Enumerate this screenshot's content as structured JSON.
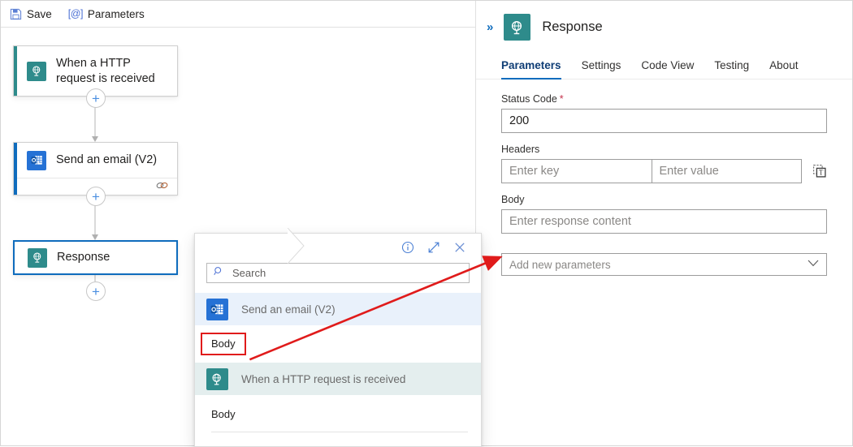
{
  "toolbar": {
    "save_label": "Save",
    "save_icon": "save-floppy-icon",
    "parameters_label": "Parameters",
    "parameters_icon": "at-parameters-icon"
  },
  "canvas": {
    "nodes": [
      {
        "id": "http-trigger",
        "label": "When a HTTP request is received",
        "icon": "http-request-globe-icon",
        "accent_color": "#2e8b8b",
        "selected": false
      },
      {
        "id": "send-email",
        "label": "Send an email (V2)",
        "icon": "outlook-email-icon",
        "accent_color": "#0f6cbd",
        "selected": false,
        "connection_icon": "chain-link-icon"
      },
      {
        "id": "response",
        "label": "Response",
        "icon": "response-globe-icon",
        "accent_color": "#0f6cbd",
        "selected": true
      }
    ],
    "add_button_label": "+"
  },
  "panel": {
    "collapse_icon": "double-chevron-right-icon",
    "header_icon": "response-globe-icon",
    "title": "Response",
    "tabs": [
      {
        "label": "Parameters",
        "active": true
      },
      {
        "label": "Settings",
        "active": false
      },
      {
        "label": "Code View",
        "active": false
      },
      {
        "label": "Testing",
        "active": false
      },
      {
        "label": "About",
        "active": false
      }
    ],
    "fields": {
      "status_code": {
        "label": "Status Code",
        "required_marker": "*",
        "value": "200"
      },
      "headers": {
        "label": "Headers",
        "key_placeholder": "Enter key",
        "value_placeholder": "Enter value",
        "text_mode_icon": "switch-to-text-mode-icon"
      },
      "body": {
        "label": "Body",
        "placeholder": "Enter response content"
      }
    },
    "add_new_parameters": {
      "label": "Add new parameters",
      "chevron": "∨"
    }
  },
  "popup": {
    "info_icon": "info-circle-icon",
    "expand_icon": "expand-diagonal-icon",
    "close_icon": "close-x-icon",
    "search": {
      "placeholder": "Search",
      "icon": "search-icon"
    },
    "groups": [
      {
        "title": "Send an email (V2)",
        "icon": "outlook-email-icon",
        "background": "#e9f1fb",
        "items": [
          {
            "label": "Body",
            "highlighted": true
          }
        ]
      },
      {
        "title": "When a HTTP request is received",
        "icon": "http-request-globe-icon",
        "background": "#e4eeee",
        "items": [
          {
            "label": "Body",
            "highlighted": false
          }
        ]
      }
    ]
  },
  "annotation": {
    "arrow_color": "#e01b1b",
    "highlight_color": "#e01b1b"
  }
}
